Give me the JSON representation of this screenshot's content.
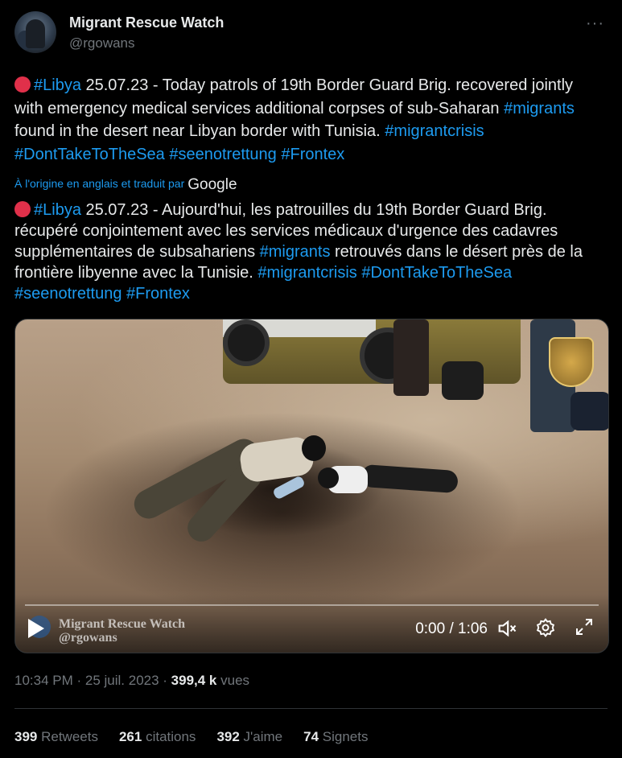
{
  "author": {
    "name": "Migrant Rescue Watch",
    "handle": "@rgowans",
    "avatar_icon": "profile-avatar",
    "more_icon": "more-horizontal-icon"
  },
  "tweet": {
    "original": {
      "hashtag1": "#Libya",
      "text_a": " 25.07.23 - Today patrols of 19th Border Guard Brig. recovered jointly with emergency medical services additional corpses of sub-Saharan ",
      "hashtag2": "#migrants",
      "text_b": " found in the desert near Libyan border with Tunisia. ",
      "hashtag3": "#migrantcrisis",
      "hashtag4": "#DontTakeToTheSea",
      "hashtag5": "#seenotrettung",
      "hashtag6": "#Frontex"
    },
    "translation_note": "À l'origine en anglais et traduit par",
    "translation_provider": "Google",
    "translated": {
      "hashtag1": "#Libya",
      "text_a": " 25.07.23 - Aujourd'hui, les patrouilles du 19th Border Guard Brig. récupéré conjointement avec les services médicaux d'urgence des cadavres supplémentaires de subsahariens ",
      "hashtag2": "#migrants",
      "text_b": " retrouvés dans le désert près de la frontière libyenne avec la Tunisie. ",
      "hashtag3": "#migrantcrisis",
      "hashtag4": "#DontTakeToTheSea",
      "hashtag5": "#seenotrettung",
      "hashtag6": "#Frontex"
    },
    "red_dot_color": "#e0304a",
    "link_color": "#1d9bf0"
  },
  "video": {
    "watermark_line1": "Migrant Rescue Watch",
    "watermark_line2": "@rgowans",
    "current_time": "0:00",
    "separator": " / ",
    "duration": "1:06",
    "progress": 0
  },
  "meta": {
    "time": "10:34 PM",
    "sep1": " · ",
    "date": "25 juil. 2023",
    "sep2": " · ",
    "views_count": "399,4 k",
    "views_label": " vues"
  },
  "stats": {
    "retweets_count": "399",
    "retweets_label": " Retweets",
    "quotes_count": "261",
    "quotes_label": " citations",
    "likes_count": "392",
    "likes_label": " J'aime",
    "bookmarks_count": "74",
    "bookmarks_label": " Signets"
  }
}
